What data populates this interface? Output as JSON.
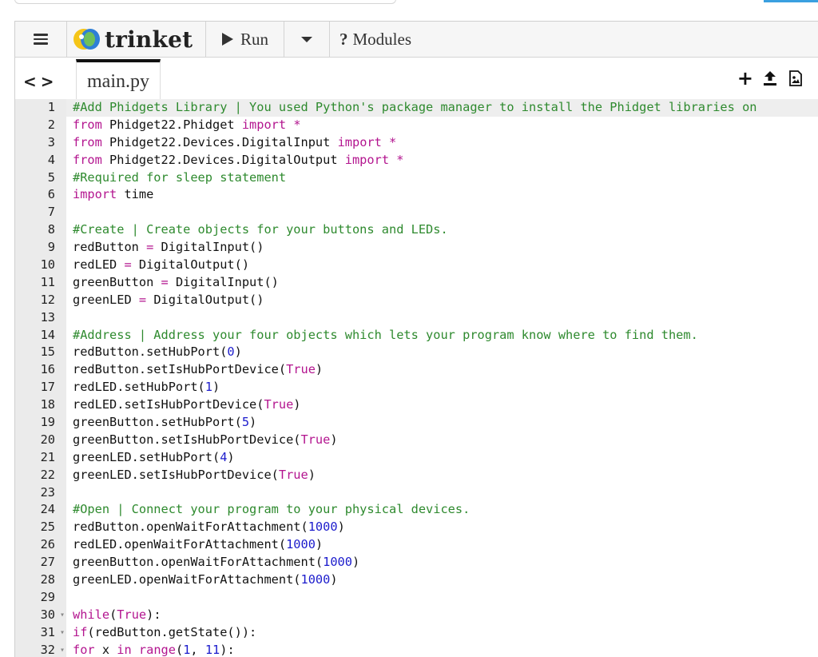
{
  "toolbar": {
    "logo_text": "trinket",
    "run_label": "Run",
    "modules_label": "Modules",
    "modules_icon": "question-mark"
  },
  "tabs": [
    {
      "label": "main.py",
      "active": true
    }
  ],
  "colors": {
    "comment": "#2e8a2e",
    "keyword": "#b3158f",
    "number": "#1b1bcc",
    "gutter_bg": "#ebebeb"
  },
  "code": {
    "line_numbers": [
      "1",
      "2",
      "3",
      "4",
      "5",
      "6",
      "7",
      "8",
      "9",
      "10",
      "11",
      "12",
      "13",
      "14",
      "15",
      "16",
      "17",
      "18",
      "19",
      "20",
      "21",
      "22",
      "23",
      "24",
      "25",
      "26",
      "27",
      "28",
      "29",
      "30",
      "31",
      "32"
    ],
    "fold_lines": [
      30,
      31,
      32
    ],
    "lines": [
      [
        [
          "c",
          "#Add Phidgets Library | You used Python's package manager to install the Phidget libraries on"
        ]
      ],
      [
        [
          "k",
          "from"
        ],
        [
          "t",
          " Phidget22.Phidget "
        ],
        [
          "k",
          "import"
        ],
        [
          "t",
          " "
        ],
        [
          "o",
          "*"
        ]
      ],
      [
        [
          "k",
          "from"
        ],
        [
          "t",
          " Phidget22.Devices.DigitalInput "
        ],
        [
          "k",
          "import"
        ],
        [
          "t",
          " "
        ],
        [
          "o",
          "*"
        ]
      ],
      [
        [
          "k",
          "from"
        ],
        [
          "t",
          " Phidget22.Devices.DigitalOutput "
        ],
        [
          "k",
          "import"
        ],
        [
          "t",
          " "
        ],
        [
          "o",
          "*"
        ]
      ],
      [
        [
          "c",
          "#Required for sleep statement"
        ]
      ],
      [
        [
          "k",
          "import"
        ],
        [
          "t",
          " time"
        ]
      ],
      [
        [
          "t",
          ""
        ]
      ],
      [
        [
          "c",
          "#Create | Create objects for your buttons and LEDs."
        ]
      ],
      [
        [
          "t",
          "redButton "
        ],
        [
          "o",
          "="
        ],
        [
          "t",
          " DigitalInput()"
        ]
      ],
      [
        [
          "t",
          "redLED "
        ],
        [
          "o",
          "="
        ],
        [
          "t",
          " DigitalOutput()"
        ]
      ],
      [
        [
          "t",
          "greenButton "
        ],
        [
          "o",
          "="
        ],
        [
          "t",
          " DigitalInput()"
        ]
      ],
      [
        [
          "t",
          "greenLED "
        ],
        [
          "o",
          "="
        ],
        [
          "t",
          " DigitalOutput()"
        ]
      ],
      [
        [
          "t",
          ""
        ]
      ],
      [
        [
          "c",
          "#Address | Address your four objects which lets your program know where to find them."
        ]
      ],
      [
        [
          "t",
          "redButton.setHubPort("
        ],
        [
          "n",
          "0"
        ],
        [
          "t",
          ")"
        ]
      ],
      [
        [
          "t",
          "redButton.setIsHubPortDevice("
        ],
        [
          "k",
          "True"
        ],
        [
          "t",
          ")"
        ]
      ],
      [
        [
          "t",
          "redLED.setHubPort("
        ],
        [
          "n",
          "1"
        ],
        [
          "t",
          ")"
        ]
      ],
      [
        [
          "t",
          "redLED.setIsHubPortDevice("
        ],
        [
          "k",
          "True"
        ],
        [
          "t",
          ")"
        ]
      ],
      [
        [
          "t",
          "greenButton.setHubPort("
        ],
        [
          "n",
          "5"
        ],
        [
          "t",
          ")"
        ]
      ],
      [
        [
          "t",
          "greenButton.setIsHubPortDevice("
        ],
        [
          "k",
          "True"
        ],
        [
          "t",
          ")"
        ]
      ],
      [
        [
          "t",
          "greenLED.setHubPort("
        ],
        [
          "n",
          "4"
        ],
        [
          "t",
          ")"
        ]
      ],
      [
        [
          "t",
          "greenLED.setIsHubPortDevice("
        ],
        [
          "k",
          "True"
        ],
        [
          "t",
          ")"
        ]
      ],
      [
        [
          "t",
          ""
        ]
      ],
      [
        [
          "c",
          "#Open | Connect your program to your physical devices."
        ]
      ],
      [
        [
          "t",
          "redButton.openWaitForAttachment("
        ],
        [
          "n",
          "1000"
        ],
        [
          "t",
          ")"
        ]
      ],
      [
        [
          "t",
          "redLED.openWaitForAttachment("
        ],
        [
          "n",
          "1000"
        ],
        [
          "t",
          ")"
        ]
      ],
      [
        [
          "t",
          "greenButton.openWaitForAttachment("
        ],
        [
          "n",
          "1000"
        ],
        [
          "t",
          ")"
        ]
      ],
      [
        [
          "t",
          "greenLED.openWaitForAttachment("
        ],
        [
          "n",
          "1000"
        ],
        [
          "t",
          ")"
        ]
      ],
      [
        [
          "t",
          ""
        ]
      ],
      [
        [
          "k",
          "while"
        ],
        [
          "t",
          "("
        ],
        [
          "k",
          "True"
        ],
        [
          "t",
          "):"
        ]
      ],
      [
        [
          "k",
          "if"
        ],
        [
          "t",
          "(redButton.getState()):"
        ]
      ],
      [
        [
          "k",
          "for"
        ],
        [
          "t",
          " x "
        ],
        [
          "k",
          "in"
        ],
        [
          "t",
          " "
        ],
        [
          "k",
          "range"
        ],
        [
          "t",
          "("
        ],
        [
          "n",
          "1"
        ],
        [
          "t",
          ", "
        ],
        [
          "n",
          "11"
        ],
        [
          "t",
          "):"
        ]
      ]
    ]
  }
}
